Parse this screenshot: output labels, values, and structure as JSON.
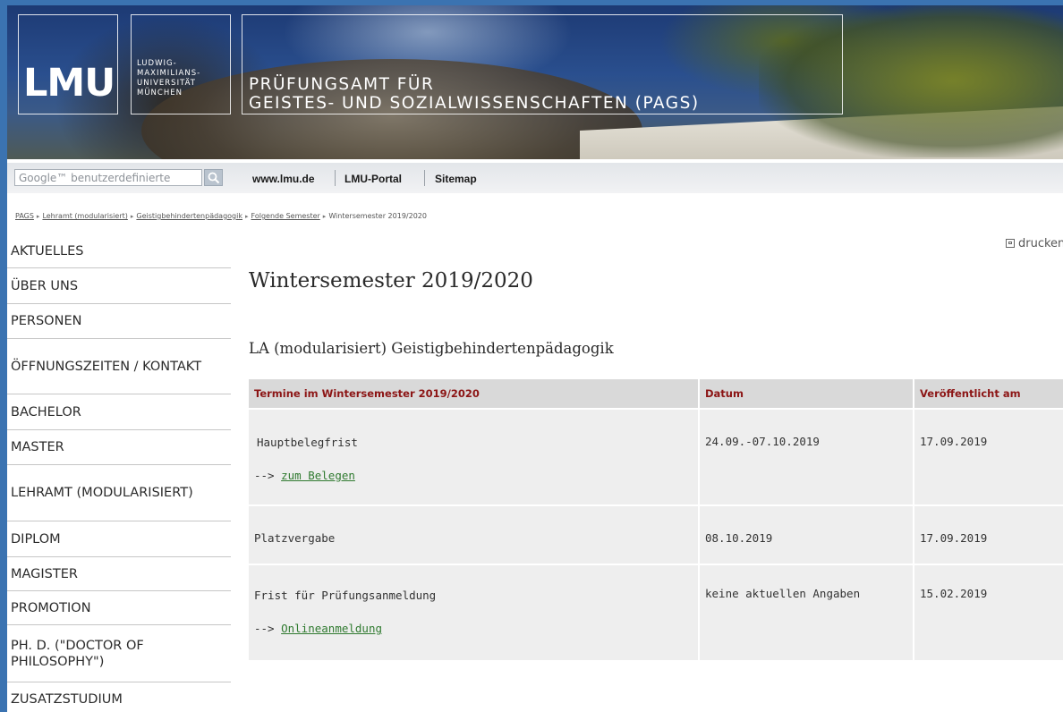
{
  "header": {
    "logo_text": "LMU",
    "university_name": "LUDWIG-\nMAXIMILIANS-\nUNIVERSITÄT\nMÜNCHEN",
    "office_title": "PRÜFUNGSAMT FÜR\nGEISTES- UND SOZIALWISSENSCHAFTEN (PAGS)"
  },
  "topnav": {
    "search_placeholder": "Google™ benutzerdefinierte",
    "links": [
      "www.lmu.de",
      "LMU-Portal",
      "Sitemap"
    ]
  },
  "breadcrumb": {
    "items": [
      "PAGS",
      "Lehramt (modularisiert)",
      "Geistigbehindertenpädagogik",
      "Folgende Semester"
    ],
    "current": "Wintersemester 2019/2020"
  },
  "sidebar": {
    "items": [
      "AKTUELLES",
      "ÜBER UNS",
      "PERSONEN",
      "ÖFFNUNGSZEITEN / KONTAKT",
      "BACHELOR",
      "MASTER",
      "LEHRAMT (MODULARISIERT)",
      "DIPLOM",
      "MAGISTER",
      "PROMOTION",
      "PH. D. (\"DOCTOR OF PHILOSOPHY\")",
      "ZUSATZSTUDIUM"
    ]
  },
  "main": {
    "print_label": "drucken",
    "title": "Wintersemester 2019/2020",
    "section_title": "LA (modularisiert) Geistigbehindertenpädagogik",
    "table": {
      "headers": [
        "Termine im Wintersemester 2019/2020",
        "Datum",
        "Veröffentlicht am"
      ],
      "rows": [
        {
          "termin": "Hauptbelegfrist",
          "link_prefix": "-->",
          "link_text": "zum Belegen",
          "datum": "24.09.-07.10.2019",
          "veroeffentlicht": "17.09.2019"
        },
        {
          "termin": "Platzvergabe",
          "link_prefix": "",
          "link_text": "",
          "datum": "08.10.2019",
          "veroeffentlicht": "17.09.2019"
        },
        {
          "termin": "Frist für Prüfungsanmeldung",
          "link_prefix": "-->",
          "link_text": "Onlineanmeldung",
          "datum": "keine aktuellen Angaben",
          "veroeffentlicht": "15.02.2019"
        }
      ]
    }
  },
  "colors": {
    "outer_background": "#3b73b1",
    "table_header_text": "#8c1515",
    "table_header_bg": "#d9d9d9",
    "table_cell_bg": "#eeeeee",
    "link_green": "#2f7a2f"
  }
}
